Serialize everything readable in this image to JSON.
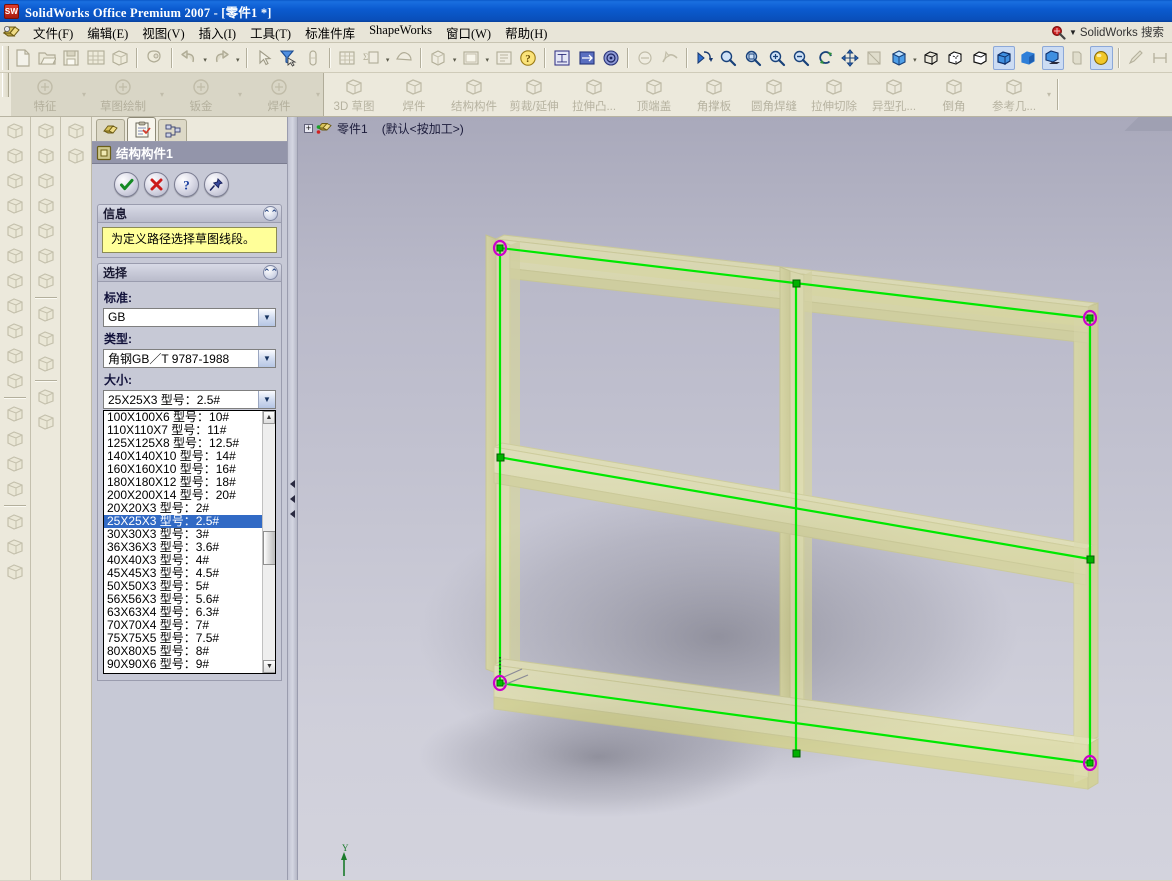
{
  "window": {
    "title": "SolidWorks Office Premium 2007 - [零件1 *]",
    "app_icon": "solidworks-logo-icon"
  },
  "menubar": {
    "logo_icon": "solidworks-app-icon",
    "items": [
      {
        "label": "文件(F)",
        "name": "menu-file"
      },
      {
        "label": "编辑(E)",
        "name": "menu-edit"
      },
      {
        "label": "视图(V)",
        "name": "menu-view"
      },
      {
        "label": "插入(I)",
        "name": "menu-insert"
      },
      {
        "label": "工具(T)",
        "name": "menu-tools"
      },
      {
        "label": "标准件库",
        "name": "menu-toolbox"
      },
      {
        "label": "ShapeWorks",
        "name": "menu-shapeworks"
      },
      {
        "label": "窗口(W)",
        "name": "menu-window"
      },
      {
        "label": "帮助(H)",
        "name": "menu-help"
      }
    ],
    "search": {
      "label": "SolidWorks 搜索",
      "icon": "search-icon",
      "caret": "▼"
    }
  },
  "toolbar": {
    "groups": [
      {
        "name": "file-group",
        "buttons": [
          {
            "name": "new-document-button",
            "icon": "new-document-icon",
            "enabled": false
          },
          {
            "name": "open-document-button",
            "icon": "open-folder-icon",
            "enabled": false
          },
          {
            "name": "save-button",
            "icon": "save-disk-icon",
            "enabled": false
          },
          {
            "name": "print-button",
            "icon": "print-icon",
            "enabled": false
          },
          {
            "name": "print3d-button",
            "icon": "print-preview-icon",
            "enabled": false
          }
        ]
      },
      {
        "name": "pack-group",
        "buttons": [
          {
            "name": "pack-and-go-button",
            "icon": "pack-go-icon",
            "enabled": false
          }
        ]
      },
      {
        "name": "undo-group",
        "buttons": [
          {
            "name": "undo-button",
            "icon": "undo-arrow-icon",
            "enabled": false,
            "caret": true
          },
          {
            "name": "redo-button",
            "icon": "redo-arrow-icon",
            "enabled": false,
            "caret": true
          }
        ]
      },
      {
        "name": "select-group",
        "buttons": [
          {
            "name": "select-button",
            "icon": "arrow-cursor-icon",
            "enabled": false
          },
          {
            "name": "filter-button",
            "icon": "selection-filter-icon",
            "enabled": true
          },
          {
            "name": "magnifier-button",
            "icon": "capsule-icon",
            "enabled": false
          }
        ]
      },
      {
        "name": "view-layout-group",
        "buttons": [
          {
            "name": "grid-button",
            "icon": "grid-icon",
            "enabled": false
          },
          {
            "name": "measure-button",
            "icon": "measure-icon",
            "enabled": false,
            "caret": true
          },
          {
            "name": "section-view-button",
            "icon": "section-icon",
            "enabled": false
          }
        ]
      },
      {
        "name": "display-group",
        "buttons": [
          {
            "name": "shaded-toggle-button",
            "icon": "cube-icon",
            "enabled": false,
            "caret": true
          },
          {
            "name": "layer-button",
            "icon": "window-icon",
            "enabled": false,
            "caret": true
          },
          {
            "name": "options-button",
            "icon": "options-icon",
            "enabled": false
          },
          {
            "name": "help-button",
            "icon": "question-help-icon",
            "enabled": true
          }
        ]
      }
    ],
    "right_groups": [
      {
        "name": "sketch-tools-group",
        "buttons": [
          {
            "name": "standard3views-button",
            "icon": "standard-views-icon",
            "enabled": true
          },
          {
            "name": "relations-button",
            "icon": "relations-icon",
            "enabled": true
          },
          {
            "name": "target-button",
            "icon": "target-icon",
            "enabled": true
          }
        ]
      },
      {
        "name": "annotation-group",
        "buttons": [
          {
            "name": "annotation-button",
            "icon": "annotation-icon",
            "enabled": false
          },
          {
            "name": "curve-button",
            "icon": "curve-icon",
            "enabled": false
          }
        ]
      },
      {
        "name": "view-nav-group",
        "buttons": [
          {
            "name": "previous-view-button",
            "icon": "previous-view-icon",
            "enabled": true
          },
          {
            "name": "zoom-to-fit-button",
            "icon": "zoom-fit-icon",
            "enabled": true
          },
          {
            "name": "zoom-to-area-button",
            "icon": "zoom-area-icon",
            "enabled": true
          },
          {
            "name": "zoom-in-out-button",
            "icon": "zoom-inout-icon",
            "enabled": true
          },
          {
            "name": "zoom-to-selection-button",
            "icon": "zoom-selection-icon",
            "enabled": true
          },
          {
            "name": "rotate-view-button",
            "icon": "rotate-view-icon",
            "enabled": true
          },
          {
            "name": "pan-button",
            "icon": "pan-move-icon",
            "enabled": true
          },
          {
            "name": "3d-drawing-view-button",
            "icon": "3d-view-icon",
            "enabled": false
          },
          {
            "name": "view-orientation-button",
            "icon": "view-orientation-icon",
            "enabled": true,
            "caret": true
          },
          {
            "name": "wireframe-button",
            "icon": "wireframe-cube-icon",
            "enabled": true
          },
          {
            "name": "hidden-lines-visible-button",
            "icon": "hidden-lines-cube-icon",
            "enabled": true
          },
          {
            "name": "hidden-lines-removed-button",
            "icon": "hlr-cube-icon",
            "enabled": true
          },
          {
            "name": "shaded-with-edges-button",
            "icon": "shaded-edges-cube-icon",
            "enabled": true,
            "pressed": true
          },
          {
            "name": "shaded-button",
            "icon": "shaded-cube-icon",
            "enabled": true,
            "pressed": false
          },
          {
            "name": "shadows-in-shaded-button",
            "icon": "shadow-cube-icon",
            "enabled": true,
            "pressed": true
          },
          {
            "name": "section-view-2-button",
            "icon": "section-cut-icon",
            "enabled": false
          },
          {
            "name": "realview-graphics-button",
            "icon": "realview-sphere-icon",
            "enabled": true,
            "pressed": true
          }
        ]
      },
      {
        "name": "sketch-end-group",
        "buttons": [
          {
            "name": "sketch-button",
            "icon": "pencil-sketch-icon",
            "enabled": false
          },
          {
            "name": "dimension-button",
            "icon": "smart-dimension-icon",
            "enabled": false
          }
        ]
      }
    ]
  },
  "command_manager": {
    "tabs": [
      {
        "label": "特征",
        "name": "cmdtab-features",
        "icon": "features-icon"
      },
      {
        "label": "草图绘制",
        "name": "cmdtab-sketch",
        "icon": "sketch-icon"
      },
      {
        "label": "钣金",
        "name": "cmdtab-sheetmetal",
        "icon": "sheetmetal-icon"
      },
      {
        "label": "焊件",
        "name": "cmdtab-weldments",
        "icon": "weldments-icon"
      }
    ],
    "buttons": [
      {
        "label": "3D 草图",
        "name": "cmd-3d-sketch",
        "icon": "3d-sketch-icon"
      },
      {
        "label": "焊件",
        "name": "cmd-weldment",
        "icon": "weldment-icon"
      },
      {
        "label": "结构构件",
        "name": "cmd-structural-member",
        "icon": "structural-member-icon"
      },
      {
        "label": "剪裁/延伸",
        "name": "cmd-trim-extend",
        "icon": "trim-extend-icon"
      },
      {
        "label": "拉伸凸...",
        "name": "cmd-extrude-boss",
        "icon": "extrude-boss-icon"
      },
      {
        "label": "顶端盖",
        "name": "cmd-end-cap",
        "icon": "end-cap-icon"
      },
      {
        "label": "角撑板",
        "name": "cmd-gusset",
        "icon": "gusset-icon"
      },
      {
        "label": "圆角焊缝",
        "name": "cmd-fillet-bead",
        "icon": "fillet-bead-icon"
      },
      {
        "label": "拉伸切除",
        "name": "cmd-extruded-cut",
        "icon": "extruded-cut-icon"
      },
      {
        "label": "异型孔...",
        "name": "cmd-hole-wizard",
        "icon": "hole-wizard-icon"
      },
      {
        "label": "倒角",
        "name": "cmd-chamfer",
        "icon": "chamfer-icon"
      },
      {
        "label": "参考几...",
        "name": "cmd-reference-geometry",
        "icon": "reference-geometry-icon"
      }
    ]
  },
  "left_toolbars": {
    "column1": [
      {
        "name": "vb-lofted-bend-icon"
      },
      {
        "name": "vb-sheetmetal-fold-icon"
      },
      {
        "name": "vb-miter-flange-icon"
      },
      {
        "name": "vb-hem-icon"
      },
      {
        "name": "vb-jog-icon"
      },
      {
        "name": "vb-break-corner-icon"
      },
      {
        "name": "vb-sketched-bend-icon"
      },
      {
        "name": "vb-closed-corner-icon"
      },
      {
        "name": "vb-forming-tool-icon"
      },
      {
        "name": "vb-extruded-cut-icon"
      },
      {
        "name": "vb-simple-hole-icon"
      },
      {
        "name": "vb-insert-bends-icon"
      },
      {
        "name": "vb-flatten-icon"
      },
      {
        "name": "vb-no-bends-icon"
      },
      {
        "name": "vb-rip-icon"
      },
      {
        "name": "vb-lofted-icon"
      },
      {
        "name": "vb-pattern1-icon"
      },
      {
        "name": "vb-pattern2-icon"
      }
    ],
    "column2": [
      {
        "name": "vb-extruded-boss-icon"
      },
      {
        "name": "vb-revolved-boss-icon"
      },
      {
        "name": "vb-swept-boss-icon"
      },
      {
        "name": "vb-lofted-boss-icon"
      },
      {
        "name": "vb-extruded-cut2-icon"
      },
      {
        "name": "vb-revolved-cut-icon"
      },
      {
        "name": "vb-fillet-icon"
      },
      {
        "name": "vb-sketch-pencil-icon"
      },
      {
        "name": "vb-3d-sketch-icon"
      },
      {
        "name": "vb-derived-sketch-icon"
      },
      {
        "name": "vb-mirror-icon"
      },
      {
        "name": "vb-pattern-icon"
      }
    ],
    "column3": [
      {
        "name": "vb-curve-through-points-icon"
      },
      {
        "name": "vb-helix-icon"
      }
    ]
  },
  "property_manager": {
    "tabs": [
      {
        "name": "feature-manager-tab",
        "icon": "feature-tree-icon",
        "active": false
      },
      {
        "name": "property-manager-tab",
        "icon": "property-clipboard-icon",
        "active": true
      },
      {
        "name": "configuration-manager-tab",
        "icon": "configuration-icon",
        "active": false
      }
    ],
    "title": "结构构件1",
    "title_icon": "structural-member-icon",
    "action_buttons": [
      {
        "name": "ok-button",
        "icon": "green-check-icon",
        "color": "#1f9a2f"
      },
      {
        "name": "cancel-button",
        "icon": "red-x-icon",
        "color": "#d42222"
      },
      {
        "name": "help-button",
        "icon": "blue-question-icon",
        "color": "#1a4fb4"
      },
      {
        "name": "pin-button",
        "icon": "pushpin-icon",
        "color": "#2a3a8c"
      }
    ],
    "info_section": {
      "title": "信息",
      "message": "为定义路径选择草图线段。",
      "collapse_icon": "chevron-up-icon"
    },
    "selection_section": {
      "title": "选择",
      "collapse_icon": "chevron-up-icon",
      "standard_label": "标准:",
      "standard_value": "GB",
      "type_label": "类型:",
      "type_value": "角钢GB／T 9787-1988",
      "size_label": "大小:",
      "size_value": "25X25X3 型号：2.5#",
      "size_options": [
        "100X100X6 型号：10#",
        "110X110X7 型号：11#",
        "125X125X8 型号：12.5#",
        "140X140X10 型号：14#",
        "160X160X10 型号：16#",
        "180X180X12 型号：18#",
        "200X200X14 型号：20#",
        "20X20X3 型号：2#",
        "25X25X3 型号：2.5#",
        "30X30X3 型号：3#",
        "36X36X3 型号：3.6#",
        "40X40X3 型号：4#",
        "45X45X3 型号：4.5#",
        "50X50X3 型号：5#",
        "56X56X3 型号：5.6#",
        "63X63X4 型号：6.3#",
        "70X70X4 型号：7#",
        "75X75X5 型号：7.5#",
        "80X80X5 型号：8#",
        "90X90X6 型号：9#"
      ],
      "selected_option_index": 8
    }
  },
  "splitter": {
    "name": "panel-splitter",
    "arrow": "◀"
  },
  "graphics": {
    "feature_tree": {
      "expand": "+",
      "part_icon": "part-document-icon",
      "part_name": "零件1",
      "configuration": "(默认<按加工>)"
    },
    "triad": {
      "axis_label": "Y",
      "color": "#1a7a2a"
    },
    "model": {
      "description": "3D structural weldment frame of angle iron",
      "body_color": "#eceb9a",
      "sketch_line_color": "#00e000",
      "endpoint_color": "#cc00cc",
      "midpoint_color": "#00aa00"
    }
  },
  "colors": {
    "titlebar_blue": "#0a58c8",
    "menubar_bg": "#e8e5d8",
    "toolbar_bg": "#ece9dc",
    "panel_bg": "#c7c9d6",
    "pm_title_bg": "#9395aa",
    "info_yellow": "#ffff99",
    "selection_blue": "#316ac5",
    "graphics_bg": "#c6c6d3"
  }
}
